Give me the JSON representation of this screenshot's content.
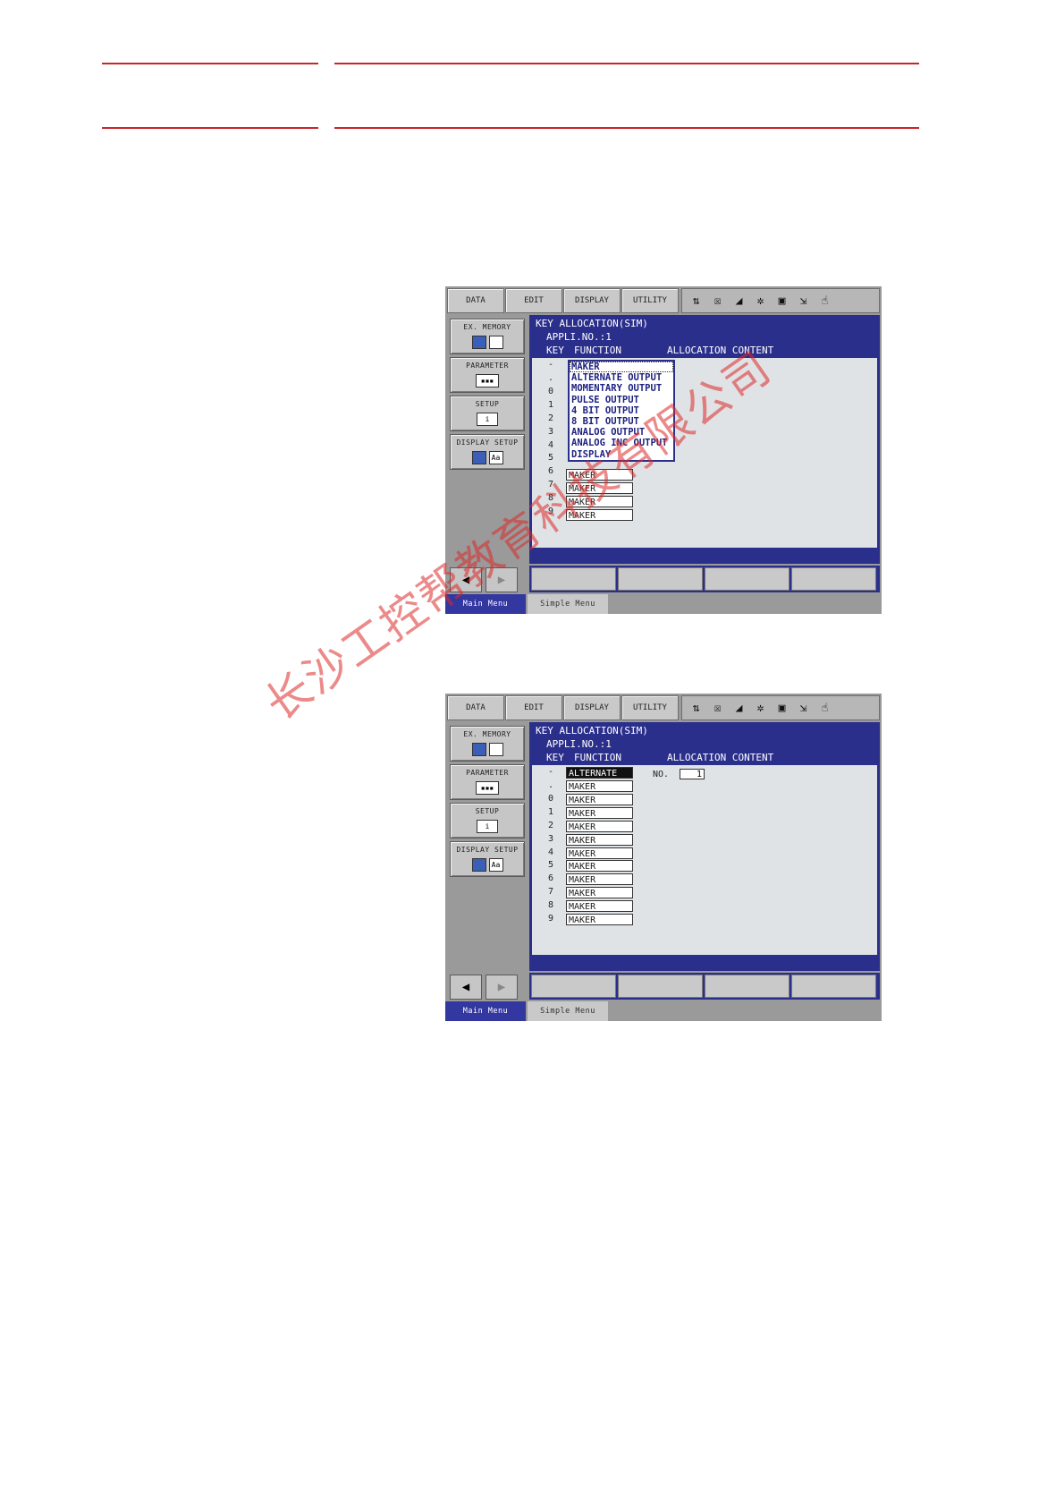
{
  "screens": [
    {
      "tabs": [
        "DATA",
        "EDIT",
        "DISPLAY",
        "UTILITY"
      ],
      "side_buttons": [
        {
          "label": "EX. MEMORY",
          "icon": "memory-card-icon"
        },
        {
          "label": "PARAMETER",
          "icon": "parameter-icon"
        },
        {
          "label": "SETUP",
          "icon": "setup-icon"
        },
        {
          "label": "DISPLAY SETUP",
          "icon": "display-setup-icon"
        }
      ],
      "header": {
        "title": "KEY ALLOCATION(SIM)",
        "appli": "APPLI.NO.:1",
        "col_key": "KEY",
        "col_function": "FUNCTION",
        "col_alloc": "ALLOCATION CONTENT"
      },
      "keys": [
        "-",
        ".",
        "0",
        "1",
        "2",
        "3",
        "4",
        "5",
        "6",
        "7",
        "8",
        "9"
      ],
      "functions": [
        "MAKER",
        "MAKER",
        "MAKER",
        "MAKER"
      ],
      "dropdown": [
        "MAKER",
        "ALTERNATE OUTPUT",
        "MOMENTARY OUTPUT",
        "PULSE OUTPUT",
        "4 BIT OUTPUT",
        "8 BIT OUTPUT",
        "ANALOG OUTPUT",
        "ANALOG INC OUTPUT",
        "DISPLAY"
      ],
      "menubar": {
        "main": "Main Menu",
        "simple": "Simple Menu"
      }
    },
    {
      "tabs": [
        "DATA",
        "EDIT",
        "DISPLAY",
        "UTILITY"
      ],
      "side_buttons": [
        {
          "label": "EX. MEMORY",
          "icon": "memory-card-icon"
        },
        {
          "label": "PARAMETER",
          "icon": "parameter-icon"
        },
        {
          "label": "SETUP",
          "icon": "setup-icon"
        },
        {
          "label": "DISPLAY SETUP",
          "icon": "display-setup-icon"
        }
      ],
      "header": {
        "title": "KEY ALLOCATION(SIM)",
        "appli": "APPLI.NO.:1",
        "col_key": "KEY",
        "col_function": "FUNCTION",
        "col_alloc": "ALLOCATION CONTENT"
      },
      "keys": [
        "-",
        ".",
        "0",
        "1",
        "2",
        "3",
        "4",
        "5",
        "6",
        "7",
        "8",
        "9"
      ],
      "functions": [
        "ALTERNATE",
        "MAKER",
        "MAKER",
        "MAKER",
        "MAKER",
        "MAKER",
        "MAKER",
        "MAKER",
        "MAKER",
        "MAKER",
        "MAKER",
        "MAKER"
      ],
      "alloc_label": "NO.",
      "alloc_value": "1",
      "menubar": {
        "main": "Main Menu",
        "simple": "Simple Menu"
      }
    }
  ],
  "watermark": "长沙工控帮教育科技有限公司",
  "colors": {
    "rule": "#c8262b",
    "panel": "#2b2f8c"
  }
}
